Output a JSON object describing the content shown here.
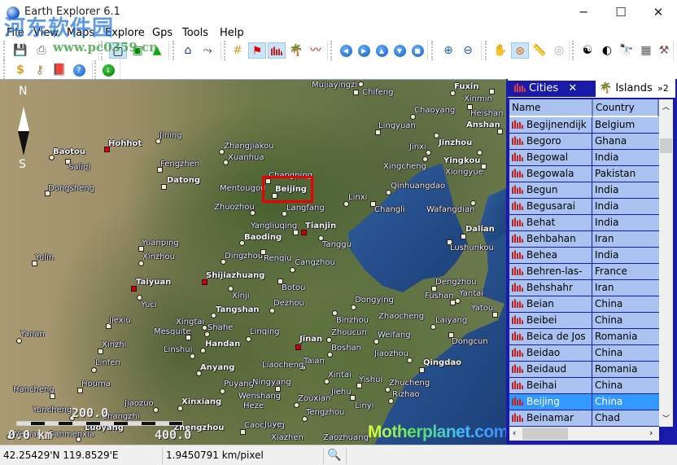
{
  "window": {
    "title": "Earth Explorer 6.1",
    "minimize": "─",
    "maximize": "☐",
    "close": "✕"
  },
  "watermark": {
    "cn": "河东软件园",
    "url": "www.pc0359.cn"
  },
  "menu": [
    "File",
    "View",
    "Maps",
    "Explore",
    "Gps",
    "Tools",
    "Help"
  ],
  "map": {
    "compass_n": "N",
    "compass_s": "S",
    "scale": {
      "mid": "200.0",
      "start": "0.0 km",
      "end": "400.0"
    },
    "logo": "Motherplanet.com",
    "cities": [
      "Hohhot",
      "Baotou",
      "Saliqi",
      "Dongsheng",
      "Jining",
      "Fengzhen",
      "Datong",
      "Zhangjiakou",
      "Xuanhua",
      "Mentougou",
      "Zhuozhou",
      "Changping",
      "Beijing",
      "Langfang",
      "Yangliuqing",
      "Tianjin",
      "Baoding",
      "Tanggu",
      "Mujiayingzi",
      "Chifeng",
      "Fuxin",
      "Xinmin",
      "Heishan",
      "Chaoyang",
      "Lingyuan",
      "Anshan",
      "Jinzhou",
      "Jinxi",
      "Yingkou",
      "Xingcheng",
      "Xiongyue",
      "Qinhuangdao",
      "Linxi",
      "Changli",
      "Wafangdian",
      "Dalian",
      "Lushunkou",
      "Yulin",
      "Yanan",
      "Yuanping",
      "Xinzhou",
      "Taiyuan",
      "Yuci",
      "Jiexiu",
      "Xinzhi",
      "Linfen",
      "Houma",
      "Hancheng",
      "Yuncheng",
      "Jiaozuo",
      "Xinxiang",
      "Changzhi",
      "Dingzhou",
      "Shijiazhuang",
      "Xinji",
      "Tangshan",
      "Xingtai",
      "Shahe",
      "Mesquite",
      "Linshui",
      "Handan",
      "Anyang",
      "Puyang",
      "Heze",
      "Weinan",
      "Sanmenxia",
      "Luoyang",
      "Zhengzhou",
      "Caocheng",
      "Xiazhen",
      "Zaozhuang",
      "Juye",
      "Tengzhou",
      "Linyi",
      "Wenshang",
      "Ningyang",
      "Zouxian",
      "Jiehu",
      "Xintai",
      "Yishui",
      "Zhucheng",
      "Rizhao",
      "Liaocheng",
      "Taian",
      "Jinan",
      "Boshan",
      "Zhoucun",
      "Linqing",
      "Dezhou",
      "Botou",
      "Cangzhou",
      "Renqiu",
      "Binzhou",
      "Dongying",
      "Zhaocheng",
      "Weifang",
      "Jiaozhou",
      "Qingdao",
      "Laiyang",
      "Dongcun",
      "Dengzhou",
      "Fushan",
      "Yantai",
      "Yatou"
    ]
  },
  "panel": {
    "tabs": {
      "cities": "Cities",
      "islands": "Islands",
      "more": "»2"
    },
    "columns": {
      "name": "Name",
      "country": "Country"
    },
    "rows": [
      {
        "name": "Begijnendijk",
        "country": "Belgium"
      },
      {
        "name": "Begoro",
        "country": "Ghana"
      },
      {
        "name": "Begowal",
        "country": "India"
      },
      {
        "name": "Begowala",
        "country": "Pakistan"
      },
      {
        "name": "Begun",
        "country": "India"
      },
      {
        "name": "Begusarai",
        "country": "India"
      },
      {
        "name": "Behat",
        "country": "India"
      },
      {
        "name": "Behbahan",
        "country": "Iran"
      },
      {
        "name": "Behea",
        "country": "India"
      },
      {
        "name": "Behren-las-",
        "country": "France"
      },
      {
        "name": "Behshahr",
        "country": "Iran"
      },
      {
        "name": "Beian",
        "country": "China"
      },
      {
        "name": "Beibei",
        "country": "China"
      },
      {
        "name": "Beica de Jos",
        "country": "Romania"
      },
      {
        "name": "Beidao",
        "country": "China"
      },
      {
        "name": "Beidaud",
        "country": "Romania"
      },
      {
        "name": "Beihai",
        "country": "China"
      },
      {
        "name": "Beijing",
        "country": "China",
        "selected": true
      },
      {
        "name": "Beinamar",
        "country": "Chad"
      }
    ]
  },
  "status": {
    "coords": "42.25429'N  119.8529'E",
    "scale": "1.9450791 km/pixel"
  }
}
